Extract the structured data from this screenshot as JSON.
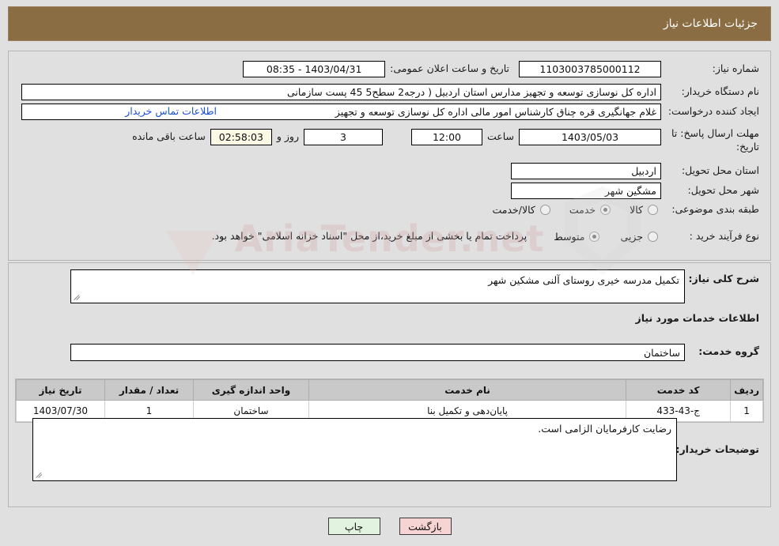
{
  "header": {
    "title": "جزئیات اطلاعات نیاز",
    "bar_color": "#8a6d42"
  },
  "form": {
    "need_number_label": "شماره نیاز:",
    "need_number_value": "1103003785000112",
    "announce_datetime_label": "تاریخ و ساعت اعلان عمومی:",
    "announce_datetime_value": "1403/04/31 - 08:35",
    "buyer_org_label": "نام دستگاه خریدار:",
    "buyer_org_value": "اداره کل نوسازی   توسعه و تجهیز مدارس استان اردبیل ( درجه2  سطح5  45 پست سازمانی",
    "requester_label": "ایجاد کننده درخواست:",
    "requester_value": "غلام جهانگیری قره چناق کارشناس امور مالی اداره کل نوسازی   توسعه و تجهیز",
    "contact_link": "اطلاعات تماس خریدار",
    "deadline_label": "مهلت ارسال پاسخ: تا تاریخ:",
    "deadline_date": "1403/05/03",
    "hour_label": "ساعت",
    "deadline_time": "12:00",
    "days_value": "3",
    "days_and_label": "روز و",
    "countdown_value": "02:58:03",
    "remaining_label": "ساعت باقی مانده",
    "province_label": "استان محل تحویل:",
    "province_value": "اردبیل",
    "city_label": "شهر محل تحویل:",
    "city_value": "مشگین شهر",
    "category_label": "طبقه بندی موضوعی:",
    "category_options": [
      "کالا",
      "خدمت",
      "کالا/خدمت"
    ],
    "category_selected": "خدمت",
    "process_label": "نوع فرآیند خرید :",
    "process_options": [
      "جزیی",
      "متوسط"
    ],
    "process_selected": "متوسط",
    "process_note": "پرداخت تمام یا بخشی از مبلغ خرید،از محل \"اسناد خزانه اسلامی\" خواهد بود."
  },
  "details": {
    "general_desc_label": "شرح کلی نیاز:",
    "general_desc_value": "تکمیل مدرسه خیری روستای آلنی مشکین شهر",
    "services_info_heading": "اطلاعات خدمات مورد نیاز",
    "service_group_label": "گروه خدمت:",
    "service_group_value": "ساختمان"
  },
  "table": {
    "columns": [
      "ردیف",
      "کد خدمت",
      "نام خدمت",
      "واحد اندازه گیری",
      "تعداد / مقدار",
      "تاریخ نیاز"
    ],
    "rows": [
      {
        "row_no": "1",
        "service_code": "ج-43-433",
        "service_name": "پایان‌دهی و تکمیل بنا",
        "unit": "ساختمان",
        "quantity": "1",
        "need_date": "1403/07/30"
      }
    ]
  },
  "notes": {
    "label": "توضیحات خریدار:",
    "value": "رضایت کارفرمایان الزامی است."
  },
  "footer": {
    "back_label": "بازگشت",
    "print_label": "چاپ"
  },
  "watermark": {
    "text": "AriaTender.net"
  }
}
